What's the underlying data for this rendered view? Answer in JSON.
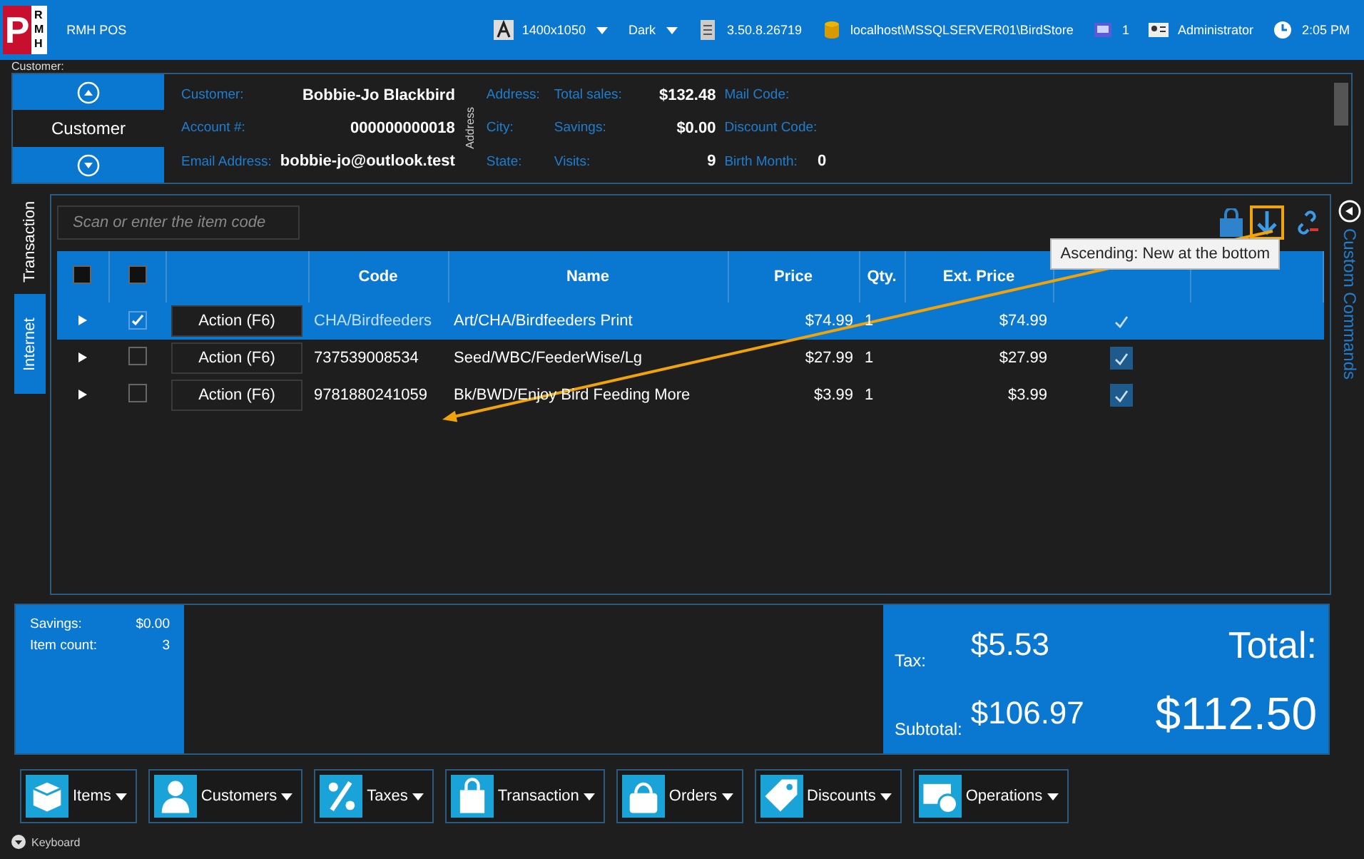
{
  "header": {
    "logo": {
      "letter": "P",
      "side": [
        "R",
        "M",
        "H"
      ]
    },
    "app_name": "RMH POS",
    "resolution": "1400x1050",
    "theme": "Dark",
    "version": "3.50.8.26719",
    "database": "localhost\\MSSQLSERVER01\\BirdStore",
    "station": "1",
    "user": "Administrator",
    "time": "2:05 PM"
  },
  "customer": {
    "section_label": "Customer:",
    "nav_label": "Customer",
    "fields": [
      {
        "label": "Customer:",
        "value": "Bobbie-Jo Blackbird"
      },
      {
        "label": "Account #:",
        "value": "000000000018"
      },
      {
        "label": "Email Address:",
        "value": "bobbie-jo@outlook.test"
      }
    ],
    "address_caption": "Address",
    "address_fields": [
      {
        "label": "Address:"
      },
      {
        "label": "City:"
      },
      {
        "label": "State:"
      }
    ],
    "stats": [
      {
        "label": "Total sales:",
        "value": "$132.48"
      },
      {
        "label": "Savings:",
        "value": "$0.00"
      },
      {
        "label": "Visits:",
        "value": "9"
      }
    ],
    "codes": [
      {
        "label": "Mail Code:"
      },
      {
        "label": "Discount Code:"
      },
      {
        "label": "Birth Month:",
        "value": "0"
      }
    ]
  },
  "side_tabs": [
    {
      "label": "Transaction",
      "selected": true
    },
    {
      "label": "Internet",
      "selected": false
    }
  ],
  "scan_field": {
    "placeholder": "Scan or enter the item code"
  },
  "tooltip": "Ascending: New at the bottom",
  "table": {
    "columns": [
      {
        "kind": "check",
        "checked": false
      },
      {
        "kind": "check",
        "checked": false
      },
      {
        "kind": "blank"
      },
      {
        "kind": "text",
        "label": "Code"
      },
      {
        "kind": "text",
        "label": "Name"
      },
      {
        "kind": "text",
        "label": "Price"
      },
      {
        "kind": "text",
        "label": "Qty."
      },
      {
        "kind": "text",
        "label": "Ext. Price"
      },
      {
        "kind": "blank"
      },
      {
        "kind": "blank"
      }
    ],
    "rows": [
      {
        "selected": true,
        "checked": true,
        "action": "Action (F6)",
        "code": "CHA/Birdfeeders",
        "name": "Art/CHA/Birdfeeders Print",
        "price": "$74.99",
        "qty": "1",
        "ext_price": "$74.99",
        "flag": true
      },
      {
        "selected": false,
        "checked": false,
        "action": "Action (F6)",
        "code": "737539008534",
        "name": "Seed/WBC/FeederWise/Lg",
        "price": "$27.99",
        "qty": "1",
        "ext_price": "$27.99",
        "flag": true
      },
      {
        "selected": false,
        "checked": false,
        "action": "Action (F6)",
        "code": "9781880241059",
        "name": "Bk/BWD/Enjoy Bird Feeding More",
        "price": "$3.99",
        "qty": "1",
        "ext_price": "$3.99",
        "flag": true
      }
    ]
  },
  "custom_commands": "Custom Commands",
  "summary": [
    {
      "label": "Savings:",
      "value": "$0.00"
    },
    {
      "label": "Item count:",
      "value": "3"
    }
  ],
  "totals": {
    "tax_label": "Tax:",
    "tax": "$5.53",
    "subtotal_label": "Subtotal:",
    "subtotal": "$106.97",
    "total_label": "Total:",
    "total": "$112.50"
  },
  "toolbar": [
    {
      "kind": "box",
      "label": "Items"
    },
    {
      "kind": "person",
      "label": "Customers"
    },
    {
      "kind": "percent",
      "label": "Taxes"
    },
    {
      "kind": "bag",
      "label": "Transaction"
    },
    {
      "kind": "basket",
      "label": "Orders"
    },
    {
      "kind": "tag",
      "label": "Discounts"
    },
    {
      "kind": "card",
      "label": "Operations"
    }
  ],
  "footer": {
    "label": "Keyboard"
  }
}
